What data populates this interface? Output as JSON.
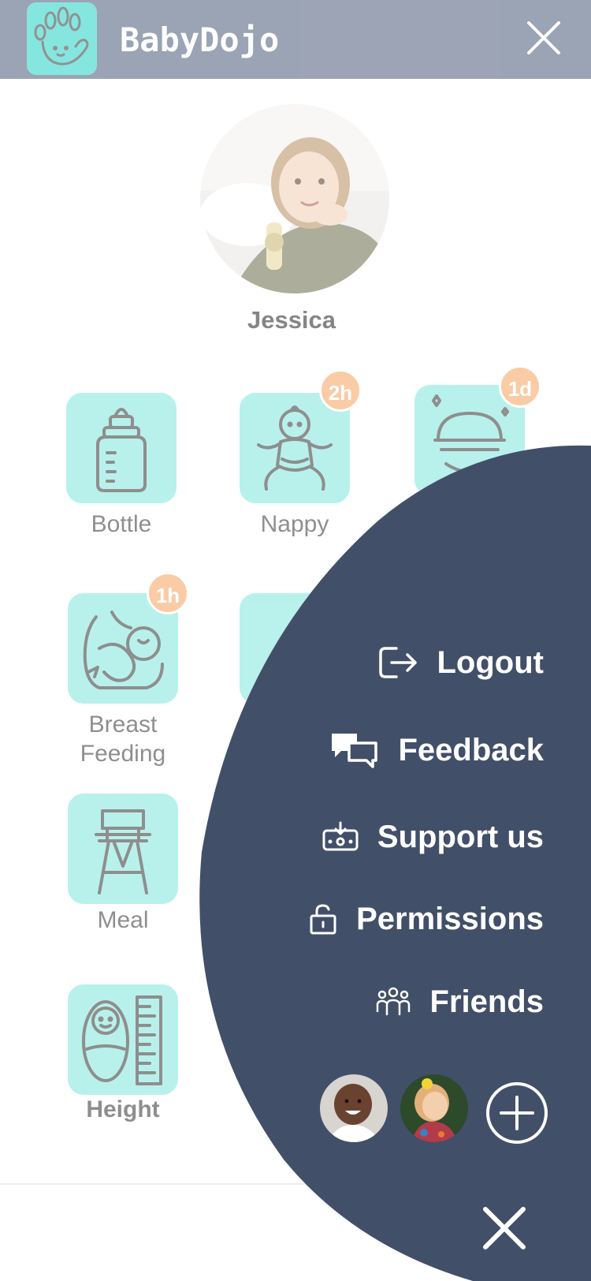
{
  "app": {
    "title": "BabyDojo",
    "logo_icon": "hand-icon",
    "close_icon": "close-icon"
  },
  "profile": {
    "name": "Jessica",
    "photo_icon": "child-photo"
  },
  "tiles": [
    {
      "label": "Bottle",
      "icon": "baby-bottle-icon",
      "badge": ""
    },
    {
      "label": "Nappy",
      "icon": "baby-nappy-icon",
      "badge": "2h"
    },
    {
      "label": "",
      "icon": "sleep-icon",
      "badge": "1d"
    },
    {
      "label": "Breast\nFeeding",
      "label_line1": "Breast",
      "label_line2": "Feeding",
      "icon": "breastfeeding-icon",
      "badge": "1h"
    },
    {
      "label": "",
      "icon": "tile-icon",
      "badge": ""
    },
    {
      "label": "Meal",
      "icon": "high-chair-icon",
      "badge": ""
    },
    {
      "label": "Height",
      "icon": "height-icon",
      "badge": ""
    }
  ],
  "menu": {
    "items": [
      {
        "label": "Logout",
        "icon": "logout-icon"
      },
      {
        "label": "Feedback",
        "icon": "chat-bubbles-icon"
      },
      {
        "label": "Support us",
        "icon": "donate-icon"
      },
      {
        "label": "Permissions",
        "icon": "lock-icon"
      },
      {
        "label": "Friends",
        "icon": "friends-icon"
      }
    ],
    "friends": [
      "friend-avatar-1",
      "friend-avatar-2"
    ],
    "add_friend_icon": "plus-circle-icon",
    "close_icon": "close-icon"
  },
  "colors": {
    "menu_background": "#424f69",
    "tile_background": "#7fe6dd",
    "badge": "#f5a35f",
    "header": "#4a5a7a"
  }
}
